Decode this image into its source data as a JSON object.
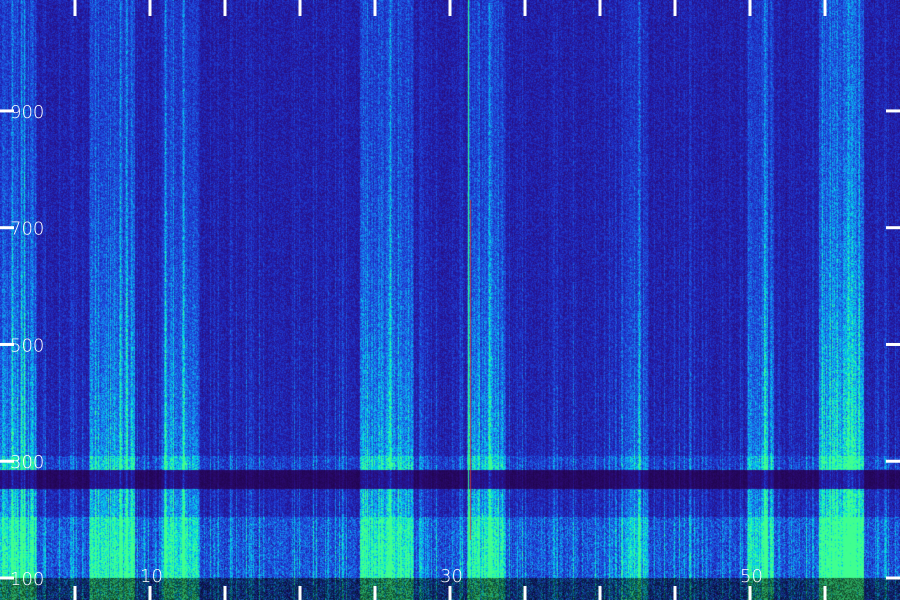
{
  "chart_data": {
    "type": "heatmap",
    "title": "",
    "xlabel": "",
    "ylabel": "",
    "x_tick_labels": [
      "10",
      "30",
      "50"
    ],
    "x_tick_values": [
      10,
      30,
      50
    ],
    "x_minor_tick_values": [
      5,
      10,
      15,
      20,
      25,
      30,
      35,
      40,
      45,
      50,
      55
    ],
    "xlim": [
      0,
      60
    ],
    "y_tick_labels": [
      "100",
      "300",
      "500",
      "700",
      "900"
    ],
    "y_tick_values": [
      100,
      300,
      500,
      700,
      900
    ],
    "ylim": [
      100,
      1090
    ],
    "colormap": [
      "#1a0033",
      "#2a0a70",
      "#2020b0",
      "#1e50e0",
      "#10a0f0",
      "#00e0e0",
      "#40ff90"
    ],
    "background_color": "#000000",
    "tick_color": "#ffffff",
    "noise_band_y": [
      250,
      300
    ],
    "bright_columns_x": [
      0.8,
      1.4,
      1.6,
      8.0,
      8.4,
      11.0,
      12.2,
      26.0,
      31.2,
      32.6,
      42.6,
      51.0,
      56.5,
      56.8
    ]
  }
}
